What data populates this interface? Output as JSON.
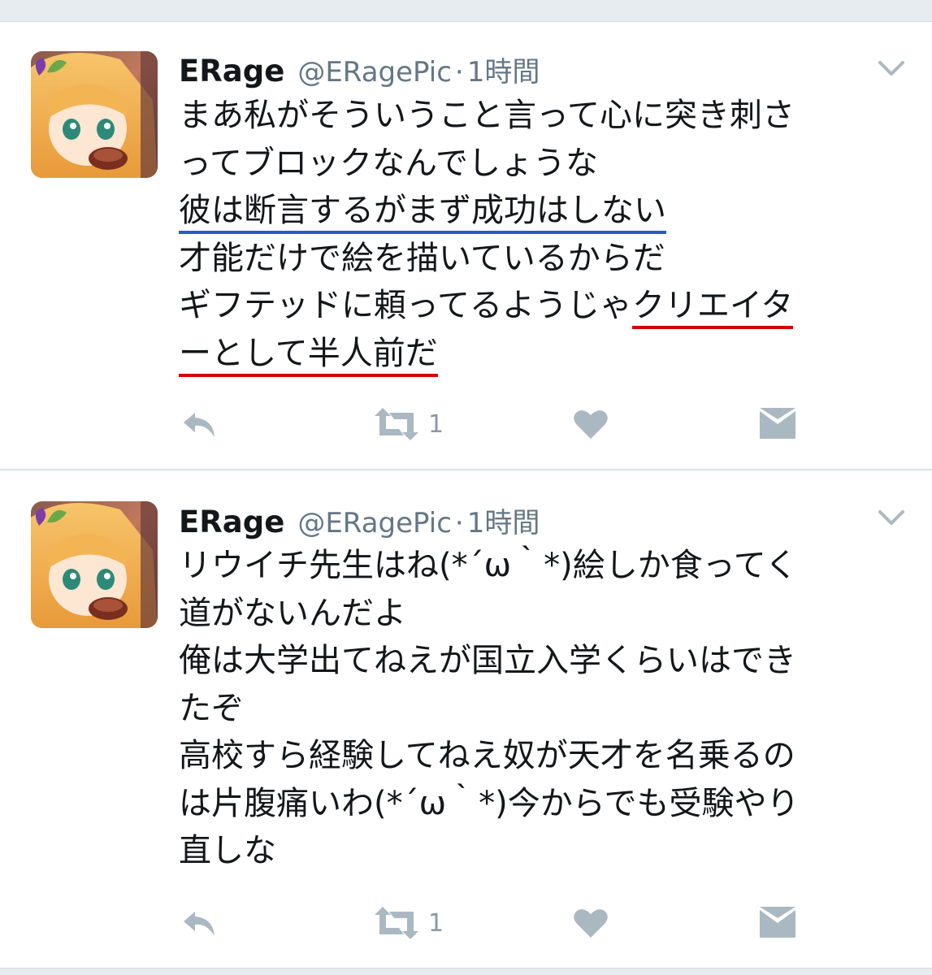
{
  "tweets": [
    {
      "name": "ERage",
      "handle": "@ERagePic",
      "separator": "·",
      "time": "1時間",
      "lines": [
        "まあ私がそういうこと言って心に突き刺さ",
        "ってブロックなんでしょうな",
        "彼は断言するがまず成功はしない",
        "才能だけで絵を描いているからだ",
        "ギフテッドに頼ってるようじゃ",
        "クリエイタ",
        "ーとして半人前だ"
      ],
      "retweet_count": "1"
    },
    {
      "name": "ERage",
      "handle": "@ERagePic",
      "separator": "·",
      "time": "1時間",
      "lines": [
        "リウイチ先生はね(*´ω｀*)絵しか食ってく",
        "道がないんだよ",
        "俺は大学出てねえが国立入学くらいはでき",
        "たぞ",
        "高校すら経験してねえ奴が天才を名乗るの",
        "は片腹痛いわ(*´ω｀*)今からでも受験やり",
        "直しな"
      ],
      "retweet_count": "1"
    }
  ],
  "icons": {
    "reply": "reply-icon",
    "retweet": "retweet-icon",
    "like": "heart-icon",
    "message": "envelope-icon",
    "caret": "chevron-down-icon"
  },
  "colors": {
    "text": "#14171a",
    "secondary": "#657786",
    "icon": "#aab8c2",
    "underline_blue": "#2a5bc6",
    "underline_red": "#d40000",
    "background": "#e6ecf0"
  }
}
